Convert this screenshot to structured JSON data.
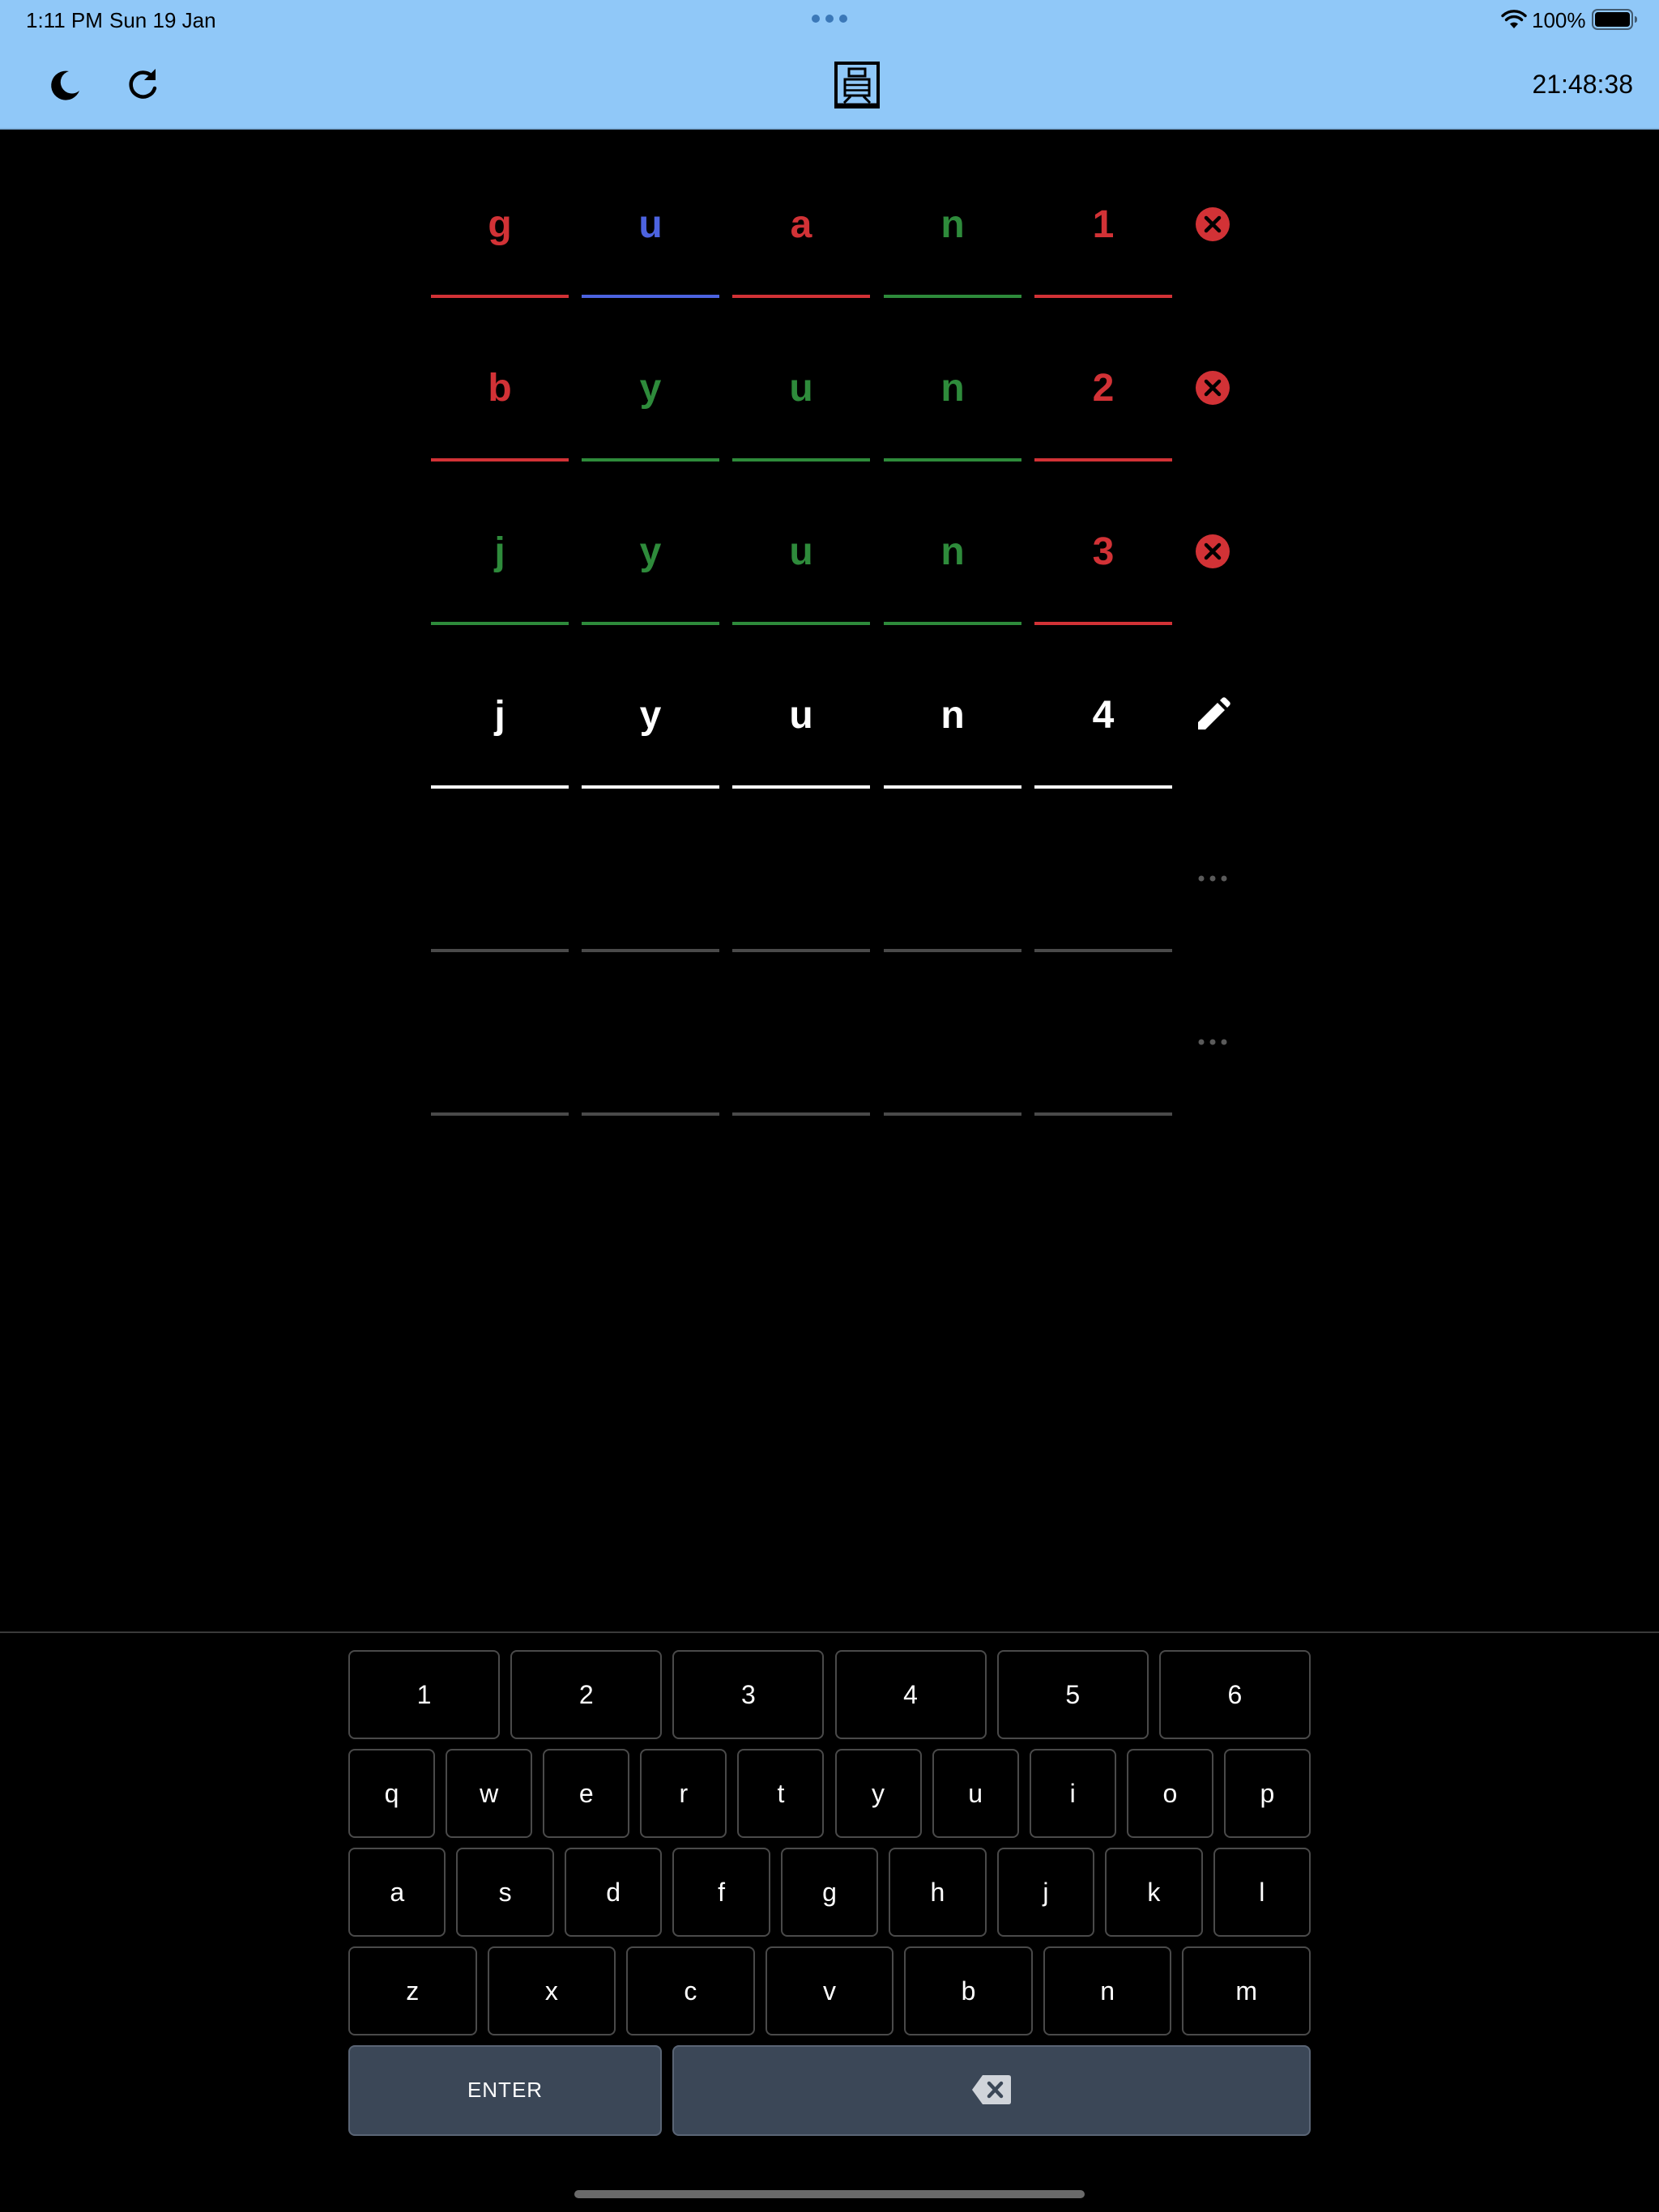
{
  "status_bar": {
    "time": "1:11 PM",
    "date": "Sun 19 Jan",
    "battery": "100%"
  },
  "header": {
    "clock": "21:48:38",
    "logo": "圓",
    "icons": [
      "moon-icon",
      "refresh-icon",
      "logo-icon"
    ],
    "background": "#90c8f8"
  },
  "colors": {
    "correct": "#2e8b3b",
    "absent": "#d23236",
    "present": "#4c63e0",
    "active": "#ffffff",
    "empty": "#4a4a4a"
  },
  "board": {
    "rows": [
      {
        "status": "wrong",
        "cells": [
          {
            "letter": "g",
            "state": "absent"
          },
          {
            "letter": "u",
            "state": "present"
          },
          {
            "letter": "a",
            "state": "absent"
          },
          {
            "letter": "n",
            "state": "correct"
          },
          {
            "letter": "1",
            "state": "absent"
          }
        ]
      },
      {
        "status": "wrong",
        "cells": [
          {
            "letter": "b",
            "state": "absent"
          },
          {
            "letter": "y",
            "state": "correct"
          },
          {
            "letter": "u",
            "state": "correct"
          },
          {
            "letter": "n",
            "state": "correct"
          },
          {
            "letter": "2",
            "state": "absent"
          }
        ]
      },
      {
        "status": "wrong",
        "cells": [
          {
            "letter": "j",
            "state": "correct"
          },
          {
            "letter": "y",
            "state": "correct"
          },
          {
            "letter": "u",
            "state": "correct"
          },
          {
            "letter": "n",
            "state": "correct"
          },
          {
            "letter": "3",
            "state": "absent"
          }
        ]
      },
      {
        "status": "editing",
        "cells": [
          {
            "letter": "j",
            "state": "active"
          },
          {
            "letter": "y",
            "state": "active"
          },
          {
            "letter": "u",
            "state": "active"
          },
          {
            "letter": "n",
            "state": "active"
          },
          {
            "letter": "4",
            "state": "active"
          }
        ]
      },
      {
        "status": "pending",
        "cells": [
          {
            "letter": "",
            "state": "empty"
          },
          {
            "letter": "",
            "state": "empty"
          },
          {
            "letter": "",
            "state": "empty"
          },
          {
            "letter": "",
            "state": "empty"
          },
          {
            "letter": "",
            "state": "empty"
          }
        ]
      },
      {
        "status": "pending",
        "cells": [
          {
            "letter": "",
            "state": "empty"
          },
          {
            "letter": "",
            "state": "empty"
          },
          {
            "letter": "",
            "state": "empty"
          },
          {
            "letter": "",
            "state": "empty"
          },
          {
            "letter": "",
            "state": "empty"
          }
        ]
      }
    ],
    "status_icons": {
      "wrong": "close-circle-icon",
      "editing": "pencil-icon",
      "pending": "ellipsis-icon"
    }
  },
  "keyboard": {
    "rows": [
      [
        "1",
        "2",
        "3",
        "4",
        "5",
        "6"
      ],
      [
        "q",
        "w",
        "e",
        "r",
        "t",
        "y",
        "u",
        "i",
        "o",
        "p"
      ],
      [
        "a",
        "s",
        "d",
        "f",
        "g",
        "h",
        "j",
        "k",
        "l"
      ],
      [
        "z",
        "x",
        "c",
        "v",
        "b",
        "n",
        "m"
      ]
    ],
    "enter_label": "ENTER",
    "backspace_icon": "backspace-icon"
  }
}
